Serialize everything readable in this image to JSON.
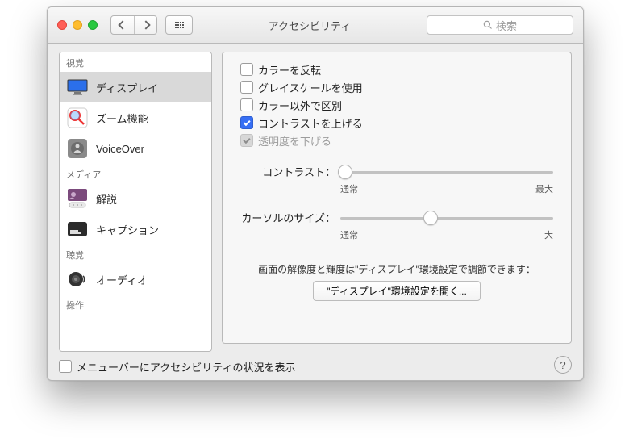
{
  "window": {
    "title": "アクセシビリティ"
  },
  "search": {
    "placeholder": "検索"
  },
  "sidebar": {
    "sections": {
      "vision": "視覚",
      "media": "メディア",
      "hearing": "聴覚",
      "interaction": "操作"
    },
    "items": {
      "display": "ディスプレイ",
      "zoom": "ズーム機能",
      "voiceover": "VoiceOver",
      "descriptions": "解説",
      "captions": "キャプション",
      "audio": "オーディオ"
    }
  },
  "checkboxes": {
    "invert_colors": "カラーを反転",
    "use_grayscale": "グレイスケールを使用",
    "differentiate": "カラー以外で区別",
    "increase_contrast": "コントラストを上げる",
    "reduce_transparency": "透明度を下げる"
  },
  "sliders": {
    "contrast_label": "コントラスト：",
    "cursor_label": "カーソルのサイズ：",
    "contrast_min": "通常",
    "contrast_max": "最大",
    "cursor_min": "通常",
    "cursor_max": "大",
    "contrast_value_pct": 2,
    "cursor_value_pct": 42
  },
  "info_text": "画面の解像度と輝度は\"ディスプレイ\"環境設定で調節できます：",
  "open_displays_button": "\"ディスプレイ\"環境設定を開く...",
  "footer": {
    "show_in_menubar": "メニューバーにアクセシビリティの状況を表示"
  }
}
